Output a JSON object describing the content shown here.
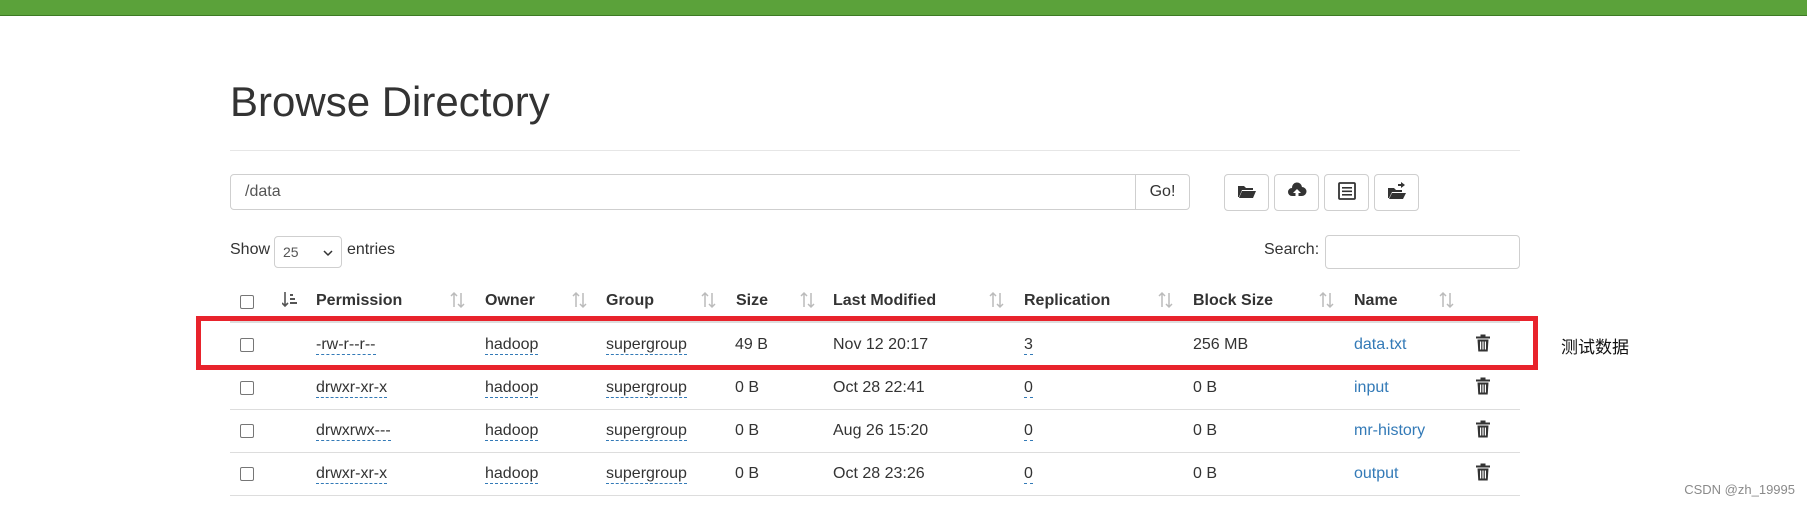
{
  "page": {
    "title": "Browse Directory",
    "path_value": "/data",
    "go_label": "Go!",
    "show_label": "Show",
    "entries_value": "25",
    "entries_label": "entries",
    "search_label": "Search:",
    "search_value": ""
  },
  "toolbar": {
    "icons": [
      "folder-open-icon",
      "cloud-upload-icon",
      "list-alt-icon",
      "cut-paste-icon"
    ]
  },
  "table": {
    "columns": [
      "Permission",
      "Owner",
      "Group",
      "Size",
      "Last Modified",
      "Replication",
      "Block Size",
      "Name"
    ],
    "rows": [
      {
        "permission": "-rw-r--r--",
        "owner": "hadoop",
        "group": "supergroup",
        "size": "49 B",
        "modified": "Nov 12 20:17",
        "replication": "3",
        "block_size": "256 MB",
        "name": "data.txt"
      },
      {
        "permission": "drwxr-xr-x",
        "owner": "hadoop",
        "group": "supergroup",
        "size": "0 B",
        "modified": "Oct 28 22:41",
        "replication": "0",
        "block_size": "0 B",
        "name": "input"
      },
      {
        "permission": "drwxrwx---",
        "owner": "hadoop",
        "group": "supergroup",
        "size": "0 B",
        "modified": "Aug 26 15:20",
        "replication": "0",
        "block_size": "0 B",
        "name": "mr-history"
      },
      {
        "permission": "drwxr-xr-x",
        "owner": "hadoop",
        "group": "supergroup",
        "size": "0 B",
        "modified": "Oct 28 23:26",
        "replication": "0",
        "block_size": "0 B",
        "name": "output"
      }
    ]
  },
  "annotation": {
    "text": "测试数据",
    "highlight_color": "#e8232c"
  },
  "watermark": "CSDN @zh_19995",
  "colors": {
    "topbar": "#5ba23a",
    "link": "#337ab7"
  }
}
